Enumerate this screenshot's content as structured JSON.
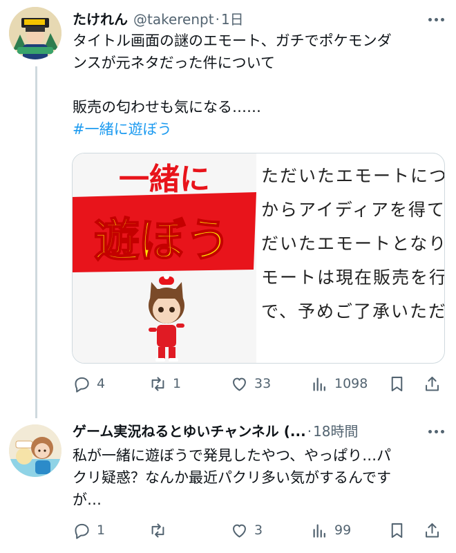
{
  "tweets": [
    {
      "display_name": "たけれん",
      "handle": "@takerenpt",
      "separator": "·",
      "time": "1日",
      "text_lines": [
        "タイトル画面の謎のエモート、ガチでポケモンダ",
        "ンスが元ネタだった件について",
        "",
        "販売の匂わせも気になる……"
      ],
      "hashtag": "#一緒に遊ぼう",
      "card": {
        "thumb_line1": "一緒に",
        "thumb_line2": "遊ぼう",
        "text_lines": [
          "ただいたエモートにつき",
          "からアイディアを得て本",
          "だいたエモートとなりま",
          "モートは現在販売を行っ",
          "で、予めご了承いただき"
        ]
      },
      "actions": {
        "replies": "4",
        "retweets": "1",
        "likes": "33",
        "views": "1098"
      }
    },
    {
      "display_name": "ゲーム実況ねるとゆいチャンネル (...",
      "separator": "·",
      "time": "18時間",
      "text_lines": [
        "私が一緒に遊ぼうで発見したやつ、やっぱり…パ",
        "クリ疑惑？なんか最近パクリ多い気がするんです",
        "が…"
      ],
      "actions": {
        "replies": "1",
        "retweets": "",
        "likes": "3",
        "views": "99"
      }
    }
  ],
  "icons": [
    "reply-icon",
    "retweet-icon",
    "like-icon",
    "views-icon",
    "bookmark-icon",
    "share-icon",
    "more-icon"
  ],
  "colors": {
    "text": "#0f1419",
    "secondary": "#536471",
    "link": "#1d9bf0",
    "border": "#cfd9de",
    "card_red": "#e8141b",
    "card_yellow": "#ffe100"
  }
}
